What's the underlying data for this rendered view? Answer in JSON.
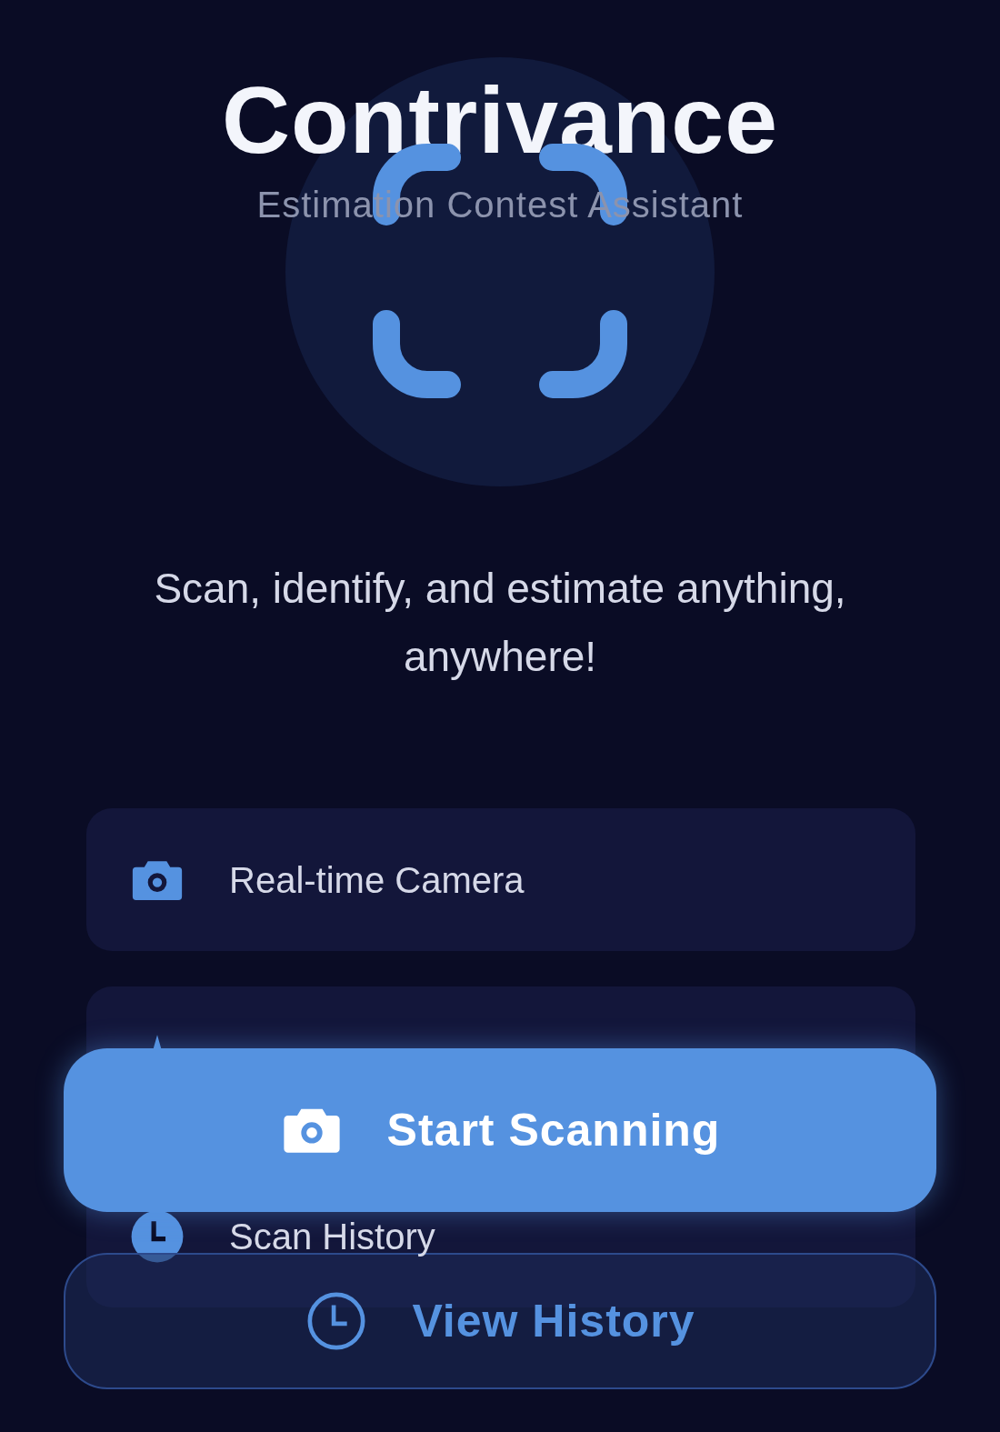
{
  "header": {
    "title": "Contrivance",
    "subtitle": "Estimation Contest Assistant"
  },
  "tagline": "Scan, identify, and estimate anything, anywhere!",
  "features": [
    {
      "kind": "card",
      "label": "Real-time Camera"
    },
    {
      "kind": "card"
    },
    {
      "kind": "card",
      "label": "Scan History"
    }
  ],
  "actions": [
    {
      "kind": "primary",
      "label": "Start Scanning"
    },
    {
      "kind": "secondary",
      "label": "View History"
    }
  ]
}
